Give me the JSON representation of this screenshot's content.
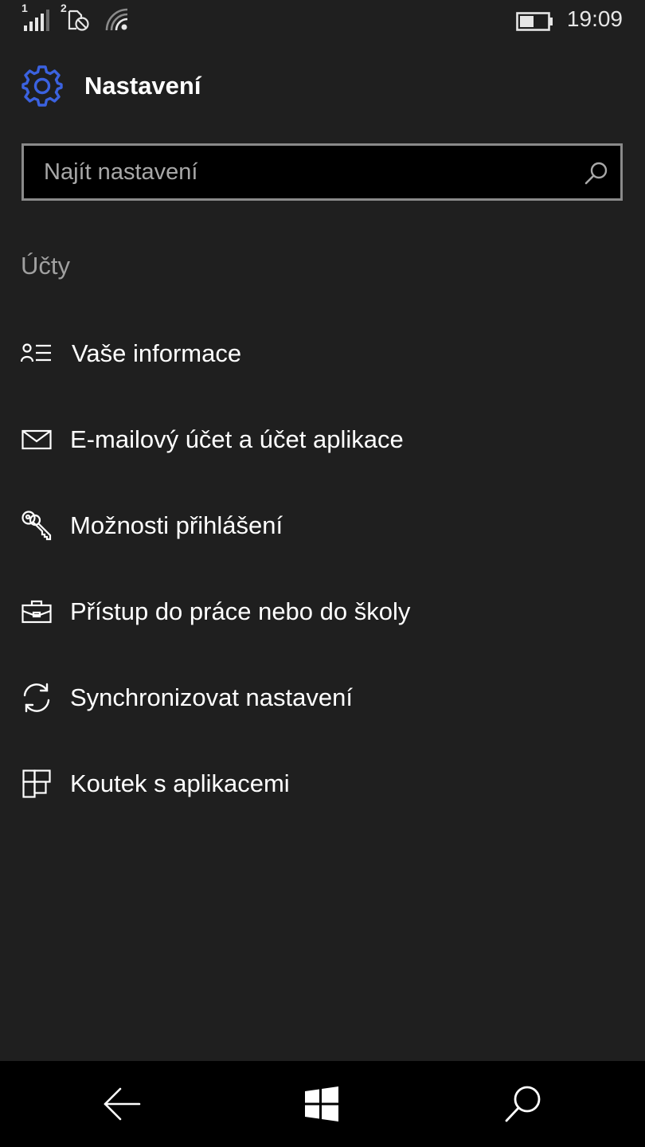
{
  "status_bar": {
    "sim1_label": "1",
    "sim2_label": "2",
    "time": "19:09",
    "battery_level": 0.5
  },
  "header": {
    "title": "Nastavení",
    "icon": "gear-icon",
    "accent_color": "#3b62e0"
  },
  "search": {
    "placeholder": "Najít nastavení",
    "value": ""
  },
  "section": {
    "title": "Účty"
  },
  "menu": {
    "items": [
      {
        "label": "Vaše informace",
        "icon": "person-list-icon"
      },
      {
        "label": "E-mailový účet a účet aplikace",
        "icon": "mail-icon"
      },
      {
        "label": "Možnosti přihlášení",
        "icon": "keys-icon"
      },
      {
        "label": "Přístup do práce nebo do školy",
        "icon": "briefcase-icon"
      },
      {
        "label": "Synchronizovat nastavení",
        "icon": "sync-icon"
      },
      {
        "label": "Koutek s aplikacemi",
        "icon": "tiles-icon"
      }
    ]
  },
  "nav_bar": {
    "back": "back-arrow-icon",
    "start": "windows-logo-icon",
    "search": "search-icon"
  }
}
